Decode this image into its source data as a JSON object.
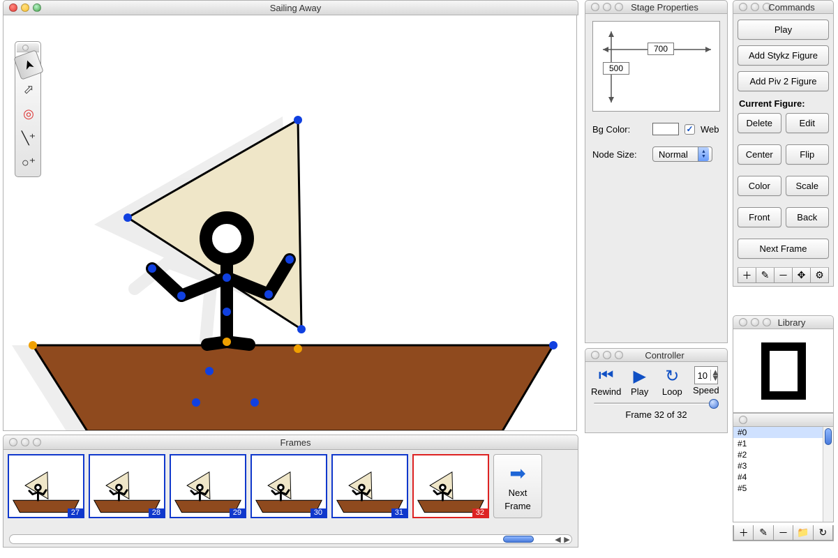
{
  "main": {
    "title": "Sailing Away"
  },
  "toolbar": {
    "tools": [
      {
        "name": "select-filled-arrow",
        "glyph": "➤",
        "selected": true
      },
      {
        "name": "select-outline-arrow",
        "glyph": "⬀"
      },
      {
        "name": "target-node",
        "glyph": "◎"
      },
      {
        "name": "add-line",
        "glyph": "╲⁺"
      },
      {
        "name": "add-circle",
        "glyph": "○⁺"
      }
    ]
  },
  "frames": {
    "title": "Frames",
    "list": [
      27,
      28,
      29,
      30,
      31,
      32
    ],
    "current": 32,
    "next_label_1": "Next",
    "next_label_2": "Frame"
  },
  "stage": {
    "title": "Stage Properties",
    "width": "700",
    "height": "500",
    "bg_label": "Bg Color:",
    "web_label": "Web",
    "web_checked": true,
    "node_label": "Node Size:",
    "node_value": "Normal"
  },
  "controller": {
    "title": "Controller",
    "rewind": "Rewind",
    "play": "Play",
    "loop": "Loop",
    "speed": "Speed",
    "speed_value": "10",
    "status_prefix": "Frame ",
    "status_mid": " of ",
    "frame": 32,
    "total": 32
  },
  "commands": {
    "title": "Commands",
    "play": "Play",
    "add_stykz": "Add Stykz Figure",
    "add_piv": "Add Piv 2 Figure",
    "heading": "Current Figure:",
    "b_delete": "Delete",
    "b_edit": "Edit",
    "b_center": "Center",
    "b_flip": "Flip",
    "b_color": "Color",
    "b_scale": "Scale",
    "b_front": "Front",
    "b_back": "Back",
    "next_frame": "Next Frame",
    "icons": [
      "＋",
      "✎",
      "－",
      "✥",
      "⚙"
    ]
  },
  "library": {
    "title": "Library",
    "items": [
      "#0",
      "#1",
      "#2",
      "#3",
      "#4",
      "#5"
    ],
    "selected": "#0",
    "icons": [
      "＋",
      "✎",
      "－",
      "📁",
      "↻"
    ]
  }
}
